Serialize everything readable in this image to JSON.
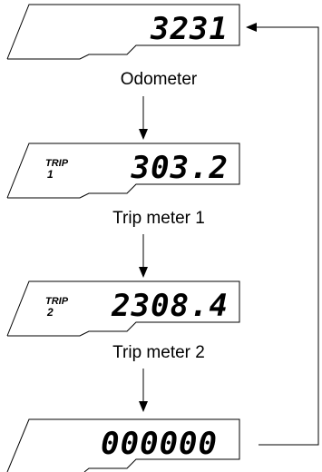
{
  "displays": [
    {
      "reading": "3231",
      "trip_label": "",
      "trip_number": "",
      "caption": "Odometer"
    },
    {
      "reading": "303.2",
      "trip_label": "TRIP",
      "trip_number": "1",
      "caption": "Trip meter 1"
    },
    {
      "reading": "2308.4",
      "trip_label": "TRIP",
      "trip_number": "2",
      "caption": "Trip meter 2"
    },
    {
      "reading": "000000",
      "trip_label": "",
      "trip_number": "",
      "caption": ""
    }
  ]
}
